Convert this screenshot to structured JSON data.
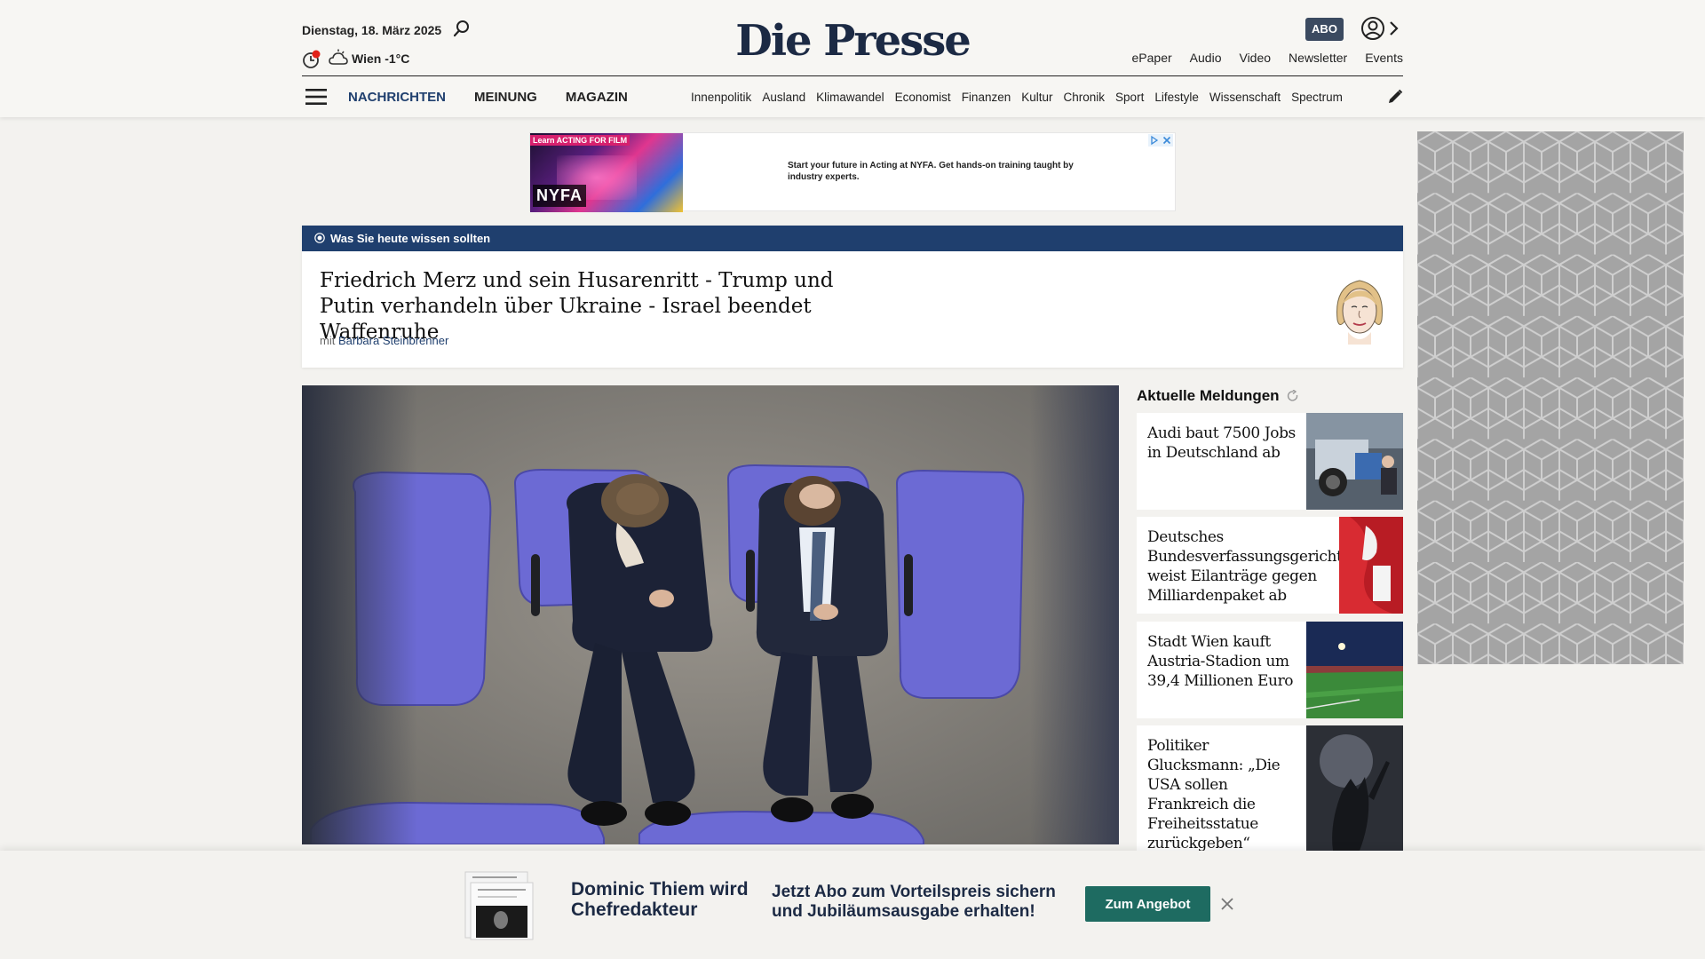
{
  "header": {
    "date": "Dienstag, 18. März 2025",
    "weather": "Wien -1°C",
    "logo": "Die Presse",
    "abo": "ABO",
    "top_links": [
      "ePaper",
      "Audio",
      "Video",
      "Newsletter",
      "Events"
    ]
  },
  "nav": {
    "main": [
      "NACHRICHTEN",
      "MEINUNG",
      "MAGAZIN"
    ],
    "sub": [
      "Innenpolitik",
      "Ausland",
      "Klimawandel",
      "Economist",
      "Finanzen",
      "Kultur",
      "Chronik",
      "Sport",
      "Lifestyle",
      "Wissenschaft",
      "Spectrum"
    ]
  },
  "ad": {
    "tag": "Learn ACTING FOR FILM",
    "brand": "NYFA",
    "text": "Start your future in Acting at NYFA. Get hands-on training taught by industry experts."
  },
  "briefing": {
    "label": "Was Sie heute wissen sollten",
    "title": "Friedrich Merz und sein Husarenritt - Trump und Putin verhandeln über Ukraine - Israel beendet Waffenruhe",
    "by_prefix": "mit",
    "author": "Barbara Steinbrenner"
  },
  "aktuell": {
    "title": "Aktuelle Meldungen",
    "items": [
      {
        "title": "Audi baut 7500 Jobs in Deutschland ab"
      },
      {
        "title": "Deutsches Bundesverfassungsgericht weist Eilanträge gegen Milliardenpaket ab"
      },
      {
        "title": "Stadt Wien kauft Austria-Stadion um 39,4 Millionen Euro"
      },
      {
        "title": "Politiker Glucksmann: „Die USA sollen Frankreich die Freiheitsstatue zurückgeben“"
      }
    ]
  },
  "promo": {
    "name": "Dominic Thiem wird Chefredakteur",
    "offer": "Jetzt Abo zum Vorteilspreis sichern und Jubiläumsausgabe erhalten!",
    "button": "Zum Angebot"
  },
  "colors": {
    "accent_blue": "#1f3f6e",
    "promo_green": "#1e6b61",
    "background": "#f3f2ef"
  }
}
